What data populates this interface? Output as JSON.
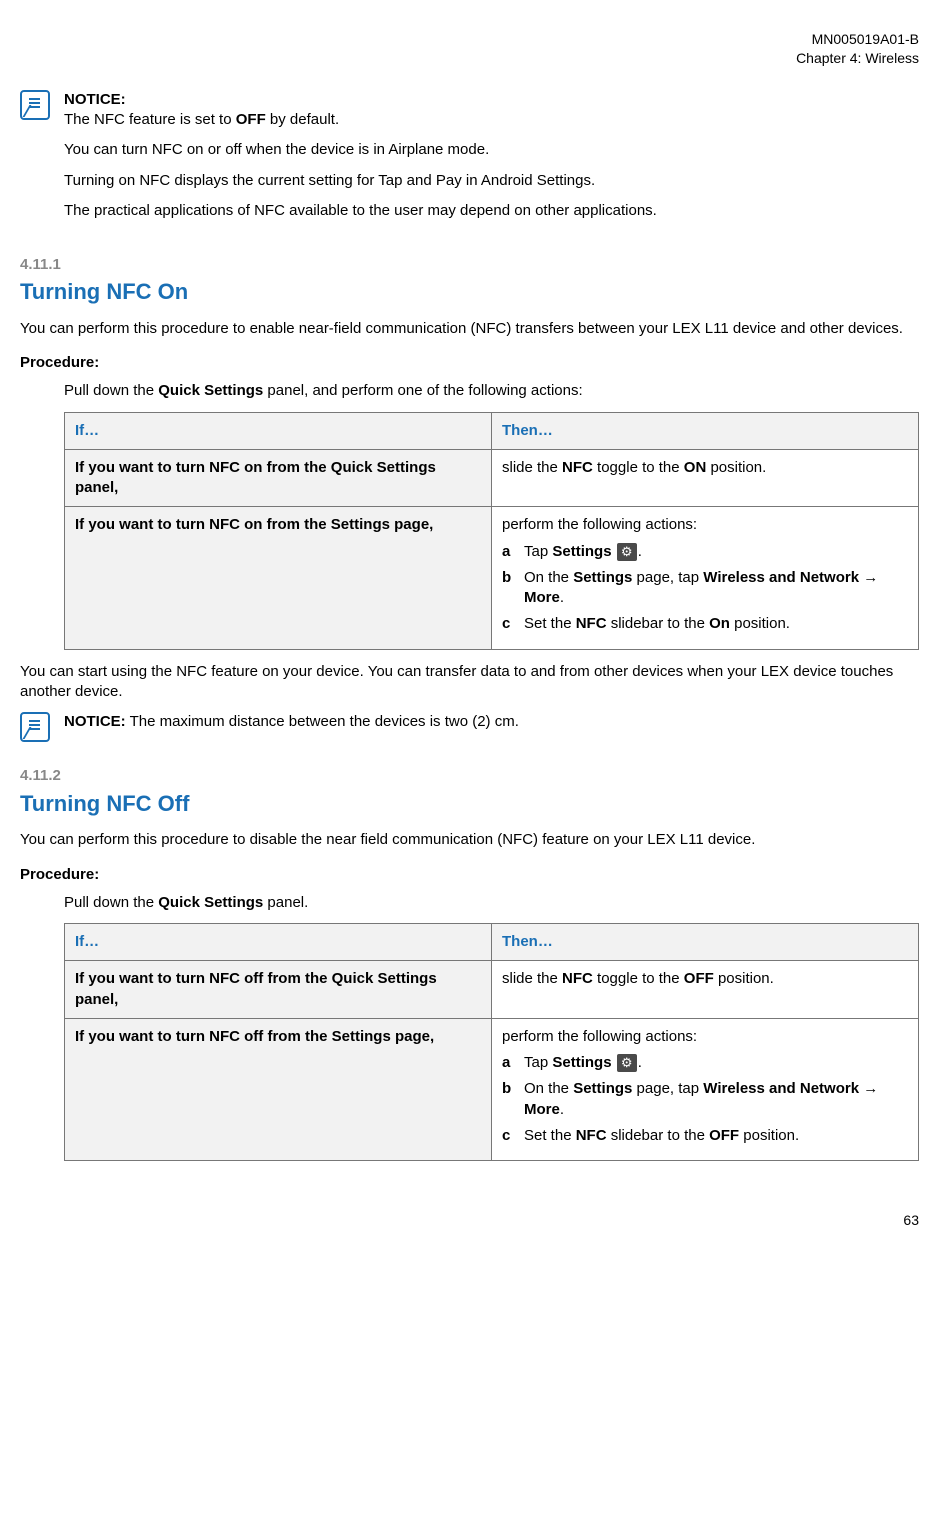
{
  "header": {
    "doc_id": "MN005019A01-B",
    "chapter": "Chapter 4:  Wireless"
  },
  "noticeA": {
    "label": "NOTICE:",
    "l1a": "The NFC feature is set to ",
    "l1b": "OFF",
    "l1c": " by default.",
    "l2": "You can turn NFC on or off when the device is in Airplane mode.",
    "l3": "Turning on NFC displays the current setting for Tap and Pay in Android Settings.",
    "l4": "The practical applications of NFC available to the user may depend on other applications."
  },
  "s1": {
    "num": "4.11.1",
    "title": "Turning NFC On",
    "intro": "You can perform this procedure to enable near-field communication (NFC) transfers between your LEX L11 device and other devices.",
    "proc_label": "Procedure:",
    "step_a": "Pull down the ",
    "step_b": "Quick Settings",
    "step_c": " panel, and perform one of the following actions:",
    "th_if": "If…",
    "th_then": "Then…",
    "r1_if": "If you want to turn NFC on from the Quick Settings panel,",
    "r1_then_a": "slide the ",
    "r1_then_b": "NFC",
    "r1_then_c": " toggle to the ",
    "r1_then_d": "ON",
    "r1_then_e": " position.",
    "r2_if": "If you want to turn NFC on from the Settings page,",
    "r2_then_lead": "perform the following actions:",
    "sa_l": "a",
    "sa_1": "Tap ",
    "sa_2": "Settings",
    "sa_3": ".",
    "sb_l": "b",
    "sb_1": "On the ",
    "sb_2": "Settings",
    "sb_3": " page, tap ",
    "sb_4": "Wireless and Network",
    "sb_5": " → ",
    "sb_6": "More",
    "sb_7": ".",
    "sc_l": "c",
    "sc_1": "Set the ",
    "sc_2": "NFC",
    "sc_3": " slidebar to the ",
    "sc_4": "On",
    "sc_5": " position.",
    "post": "You can start using the NFC feature on your device. You can transfer data to and from other devices when your LEX device touches another device.",
    "notice_label": "NOTICE:",
    "notice_text": " The maximum distance between the devices is two (2) cm."
  },
  "s2": {
    "num": "4.11.2",
    "title": "Turning NFC Off",
    "intro": "You can perform this procedure to disable the near field communication (NFC) feature on your LEX L11 device.",
    "proc_label": "Procedure:",
    "step_a": "Pull down the ",
    "step_b": "Quick Settings",
    "step_c": " panel.",
    "th_if": "If…",
    "th_then": "Then…",
    "r1_if": "If you want to turn NFC off from the Quick Settings panel,",
    "r1_then_a": "slide the ",
    "r1_then_b": "NFC",
    "r1_then_c": " toggle to the ",
    "r1_then_d": "OFF",
    "r1_then_e": " position.",
    "r2_if": "If you want to turn NFC off from the Settings page,",
    "r2_then_lead": "perform the following actions:",
    "sa_l": "a",
    "sa_1": "Tap ",
    "sa_2": "Settings",
    "sa_3": ".",
    "sb_l": "b",
    "sb_1": "On the ",
    "sb_2": "Settings",
    "sb_3": " page, tap ",
    "sb_4": "Wireless and Network",
    "sb_5": " → ",
    "sb_6": "More",
    "sb_7": ".",
    "sc_l": "c",
    "sc_1": "Set the ",
    "sc_2": "NFC",
    "sc_3": " slidebar to the ",
    "sc_4": "OFF",
    "sc_5": " position."
  },
  "page_num": "63"
}
